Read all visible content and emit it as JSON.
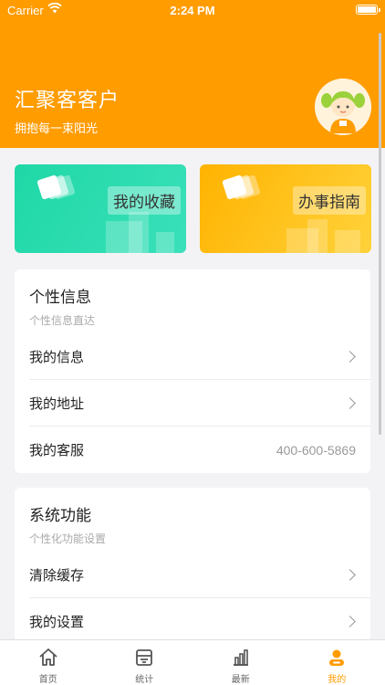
{
  "status_bar": {
    "carrier": "Carrier",
    "time": "2:24 PM"
  },
  "header": {
    "title": "汇聚客客户",
    "subtitle": "拥抱每一束阳光",
    "bg_color": "#ff9c00",
    "avatar_icon": "girl-avatar-icon"
  },
  "features": [
    {
      "label": "我的收藏",
      "color": "#1fd8a6",
      "icon": "stacked-cards-icon"
    },
    {
      "label": "办事指南",
      "color": "#ffb300",
      "icon": "stacked-cards-icon"
    }
  ],
  "personal": {
    "title": "个性信息",
    "subtitle": "个性信息直达",
    "rows": [
      {
        "label": "我的信息"
      },
      {
        "label": "我的地址"
      },
      {
        "label": "我的客服",
        "value": "400-600-5869"
      }
    ]
  },
  "system": {
    "title": "系统功能",
    "subtitle": "个性化功能设置",
    "rows": [
      {
        "label": "清除缓存"
      },
      {
        "label": "我的设置"
      }
    ]
  },
  "tabbar": {
    "accent": "#ff9c00",
    "tabs": [
      {
        "label": "首页",
        "icon": "home-icon"
      },
      {
        "label": "统计",
        "icon": "stats-icon"
      },
      {
        "label": "最新",
        "icon": "bar-chart-icon"
      },
      {
        "label": "我的",
        "icon": "profile-icon",
        "active": true
      }
    ]
  }
}
